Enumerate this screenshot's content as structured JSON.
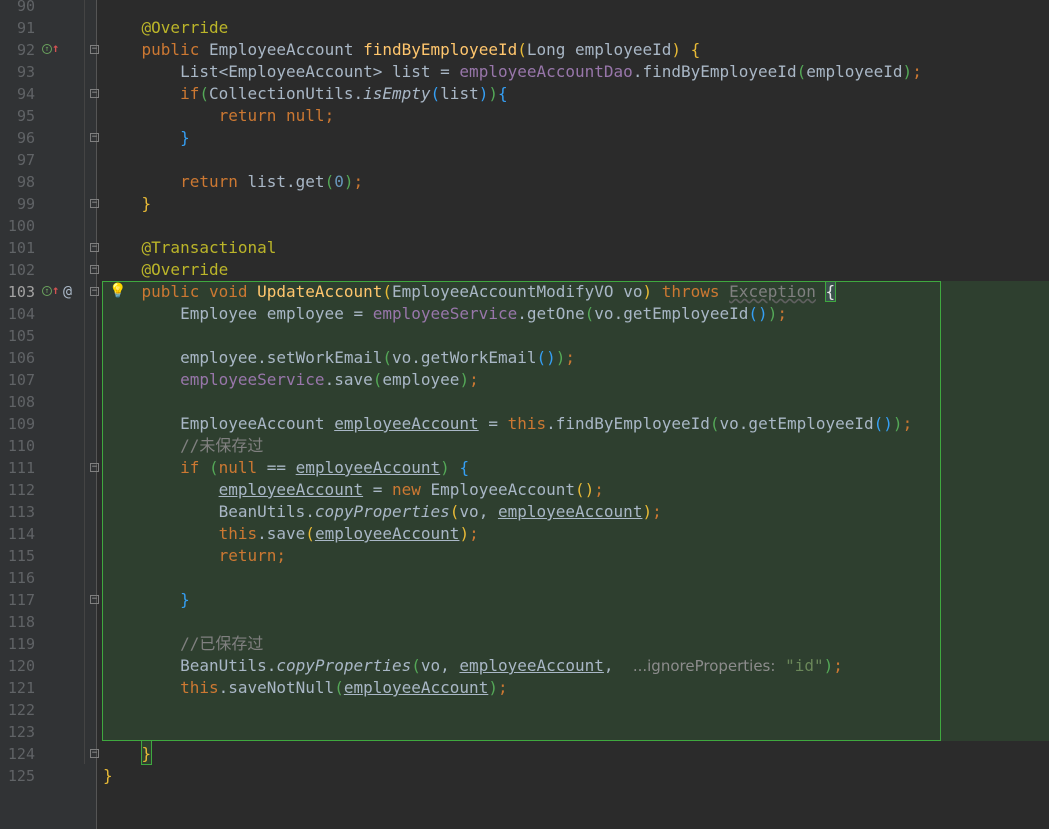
{
  "editor": {
    "line_numbers": [
      "90",
      "91",
      "92",
      "93",
      "94",
      "95",
      "96",
      "97",
      "98",
      "99",
      "100",
      "101",
      "102",
      "103",
      "104",
      "105",
      "106",
      "107",
      "108",
      "109",
      "110",
      "111",
      "112",
      "113",
      "114",
      "115",
      "116",
      "117",
      "118",
      "119",
      "120",
      "121",
      "122",
      "123",
      "124",
      "125"
    ],
    "code": {
      "l91_annotation": "@Override",
      "l92_public": "public ",
      "l92_type": "EmployeeAccount ",
      "l92_method": "findByEmployeeId",
      "l92_params": "Long employeeId",
      "l93_type": "List<EmployeeAccount> list = ",
      "l93_field": "employeeAccountDao",
      "l93_call": ".findByEmployeeId",
      "l93_arg": "employeeId",
      "l94_if": "if",
      "l94_class": "CollectionUtils.",
      "l94_method": "isEmpty",
      "l94_arg": "list",
      "l95_return": "return null",
      "l98_return": "return ",
      "l98_call": "list.get",
      "l98_num": "0",
      "l101_annotation": "@Transactional",
      "l102_annotation": "@Override",
      "l103_modifiers": "public void ",
      "l103_method": "UpdateAccount",
      "l103_params": "EmployeeAccountModifyVO vo",
      "l103_throws": "throws ",
      "l103_exception": "Exception",
      "l104_decl": "Employee employee = ",
      "l104_field": "employeeService",
      "l104_call": ".getOne",
      "l104_arg": "vo.getEmployeeId",
      "l106_call": "employee.setWorkEmail",
      "l106_arg": "vo.getWorkEmail",
      "l107_field": "employeeService",
      "l107_call": ".save",
      "l107_arg": "employee",
      "l109_type": "EmployeeAccount ",
      "l109_var": "employeeAccount",
      "l109_eq": " = ",
      "l109_this": "this",
      "l109_call": ".findByEmployeeId",
      "l109_arg": "vo.getEmployeeId",
      "l110_comment": "//未保存过",
      "l111_if": "if ",
      "l111_null": "null",
      "l111_op": " == ",
      "l111_var": "employeeAccount",
      "l112_var": "employeeAccount",
      "l112_eq": " = ",
      "l112_new": "new ",
      "l112_type": "EmployeeAccount",
      "l113_class": "BeanUtils.",
      "l113_method": "copyProperties",
      "l113_arg1": "vo, ",
      "l113_arg2": "employeeAccount",
      "l114_this": "this",
      "l114_call": ".save",
      "l114_arg": "employeeAccount",
      "l115_return": "return",
      "l119_comment": "//已保存过",
      "l120_class": "BeanUtils.",
      "l120_method": "copyProperties",
      "l120_arg1": "vo, ",
      "l120_arg2": "employeeAccount",
      "l120_hint": "...ignoreProperties:",
      "l120_string": "\"id\"",
      "l121_this": "this",
      "l121_call": ".saveNotNull",
      "l121_arg": "employeeAccount"
    },
    "punct": {
      "lp": "(",
      "rp": ")",
      "lb": "{",
      "rb": "}",
      "semi": ";",
      "rp_semi": ");",
      "pp_semi": "());",
      "pp": "()",
      "comma": ", ",
      "sp_lb": " {",
      "rp_lb": "){"
    },
    "gutter_icons": [
      "override-icon",
      "implemented-up-arrow-icon",
      "at-icon",
      "fold-icon",
      "intention-bulb-icon"
    ],
    "colors": {
      "background": "#2b2b2b",
      "gutter": "#313335",
      "selection": "#2e3f2f",
      "selection_border": "#3fa83f",
      "keyword": "#cc7832",
      "method": "#ffc66d",
      "field": "#9876aa",
      "number": "#6897bb",
      "string": "#6a8759",
      "comment": "#808080"
    }
  }
}
